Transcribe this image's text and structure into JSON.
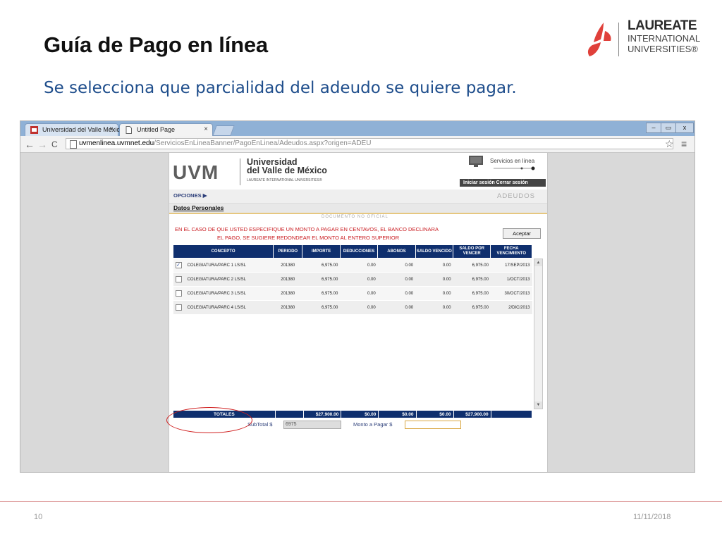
{
  "slide": {
    "title": "Guía de Pago en línea",
    "subtitle": "Se selecciona que parcialidad del adeudo se quiere pagar.",
    "logo": {
      "line1": "LAUREATE",
      "line2": "INTERNATIONAL",
      "line3": "UNIVERSITIES",
      "registered": "®",
      "mark_color": "#e0403a"
    },
    "page_number": "10",
    "date": "11/11/2018"
  },
  "browser": {
    "tabs": [
      {
        "label": "Universidad del Valle México",
        "close": "×",
        "icon": "uvm-favicon-icon"
      },
      {
        "label": "Untitled Page",
        "close": "×",
        "icon": "page-icon"
      }
    ],
    "window_buttons": {
      "minimize": "–",
      "maximize": "▭",
      "close": "x"
    },
    "nav": {
      "back": "←",
      "forward": "→",
      "reload": "C"
    },
    "address": {
      "host": "uvmenlinea.uvmnet.edu",
      "path": "/ServiciosEnLineaBanner/PagoEnLinea/Adeudos.aspx?origen=ADEU"
    },
    "star": "☆",
    "menu": "≡"
  },
  "uvm": {
    "logo": "UVM",
    "name_line1": "Universidad",
    "name_line2": "del Valle de México",
    "laureate": "LAUREATE INTERNATIONAL UNIVERSITIES®",
    "services_label": "Servicios en línea",
    "session_links": "Iniciar sesión  Cerrar sesión",
    "opciones": "OPCIONES",
    "opciones_arrow": "▶",
    "section": "ADEUDOS",
    "datos_personales": "Datos Personales",
    "documento": "DOCUMENTO NO OFICIAL",
    "warning_line1": "EN EL CASO DE QUE USTED ESPECIFIQUE UN MONTO A PAGAR EN CENTAVOS, EL BANCO DECLINARA",
    "warning_line2": "EL PAGO, SE SUGIERE REDONDEAR EL MONTO AL ENTERO SUPERIOR",
    "aceptar": "Aceptar",
    "columns": [
      "CONCEPTO",
      "PERIODO",
      "IMPORTE",
      "DEDUCCIONES",
      "ABONOS",
      "SALDO VENCIDO",
      "SALDO POR VENCER",
      "FECHA VENCIMIENTO"
    ],
    "rows": [
      {
        "checked": true,
        "concepto": "COLEGIATURA/PARC 1 LS/SL",
        "periodo": "201380",
        "importe": "6,975.00",
        "deducciones": "0.00",
        "abonos": "0.00",
        "saldo_vencido": "0.00",
        "saldo_por_vencer": "6,975.00",
        "fecha": "17/SEP/2013"
      },
      {
        "checked": false,
        "concepto": "COLEGIATURA/PARC 2 LS/SL",
        "periodo": "201380",
        "importe": "6,975.00",
        "deducciones": "0.00",
        "abonos": "0.00",
        "saldo_vencido": "0.00",
        "saldo_por_vencer": "6,975.00",
        "fecha": "1/OCT/2013"
      },
      {
        "checked": false,
        "concepto": "COLEGIATURA/PARC 3 LS/SL",
        "periodo": "201380",
        "importe": "6,975.00",
        "deducciones": "0.00",
        "abonos": "0.00",
        "saldo_vencido": "0.00",
        "saldo_por_vencer": "6,975.00",
        "fecha": "30/OCT/2013"
      },
      {
        "checked": false,
        "concepto": "COLEGIATURA/PARC 4 LS/SL",
        "periodo": "201380",
        "importe": "6,975.00",
        "deducciones": "0.00",
        "abonos": "0.00",
        "saldo_vencido": "0.00",
        "saldo_por_vencer": "6,975.00",
        "fecha": "2/DIC/2013"
      }
    ],
    "totals": {
      "label": "TOTALES",
      "importe": "$27,900.00",
      "deducciones": "$0.00",
      "abonos": "$0.00",
      "saldo_vencido": "$0.00",
      "saldo_por_vencer": "$27,900.00"
    },
    "subtotal_label": "SubTotal $",
    "subtotal_value": "6975",
    "monto_label": "Monto a Pagar $",
    "monto_value": ""
  }
}
